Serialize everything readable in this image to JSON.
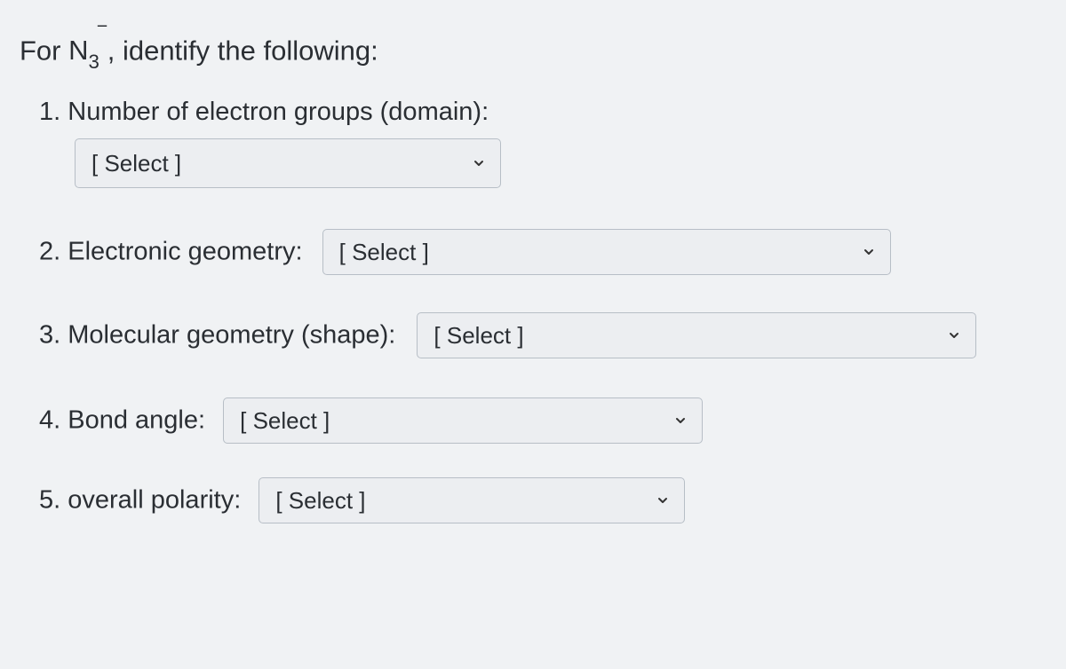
{
  "prompt": {
    "prefix": "For ",
    "formula_base": "N",
    "formula_sub": "3",
    "formula_sup": "‾",
    "suffix": ",  identify the following:"
  },
  "questions": [
    {
      "num": "1.",
      "label": "Number of electron groups (domain):",
      "placeholder": "[ Select ]"
    },
    {
      "num": "2.",
      "label": "Electronic geometry:",
      "placeholder": "[ Select ]"
    },
    {
      "num": "3.",
      "label": "Molecular geometry (shape):",
      "placeholder": "[ Select ]"
    },
    {
      "num": "4.",
      "label": "Bond angle:",
      "placeholder": "[ Select ]"
    },
    {
      "num": "5.",
      "label": "overall polarity:",
      "placeholder": "[ Select ]"
    }
  ]
}
